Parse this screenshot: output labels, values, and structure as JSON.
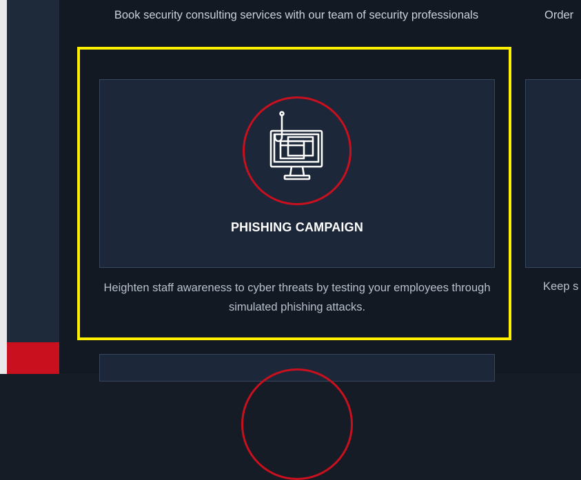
{
  "consulting": {
    "description": "Book security consulting services with our team of security professionals"
  },
  "right_column": {
    "top_text": "Order",
    "bottom_text": "Keep s"
  },
  "phishing_card": {
    "title": "PHISHING CAMPAIGN",
    "description": "Heighten staff awareness to cyber threats by testing your employees through simulated phishing attacks.",
    "icon": "phishing-monitor-icon"
  },
  "colors": {
    "accent": "#c8101e",
    "highlight": "#fff000",
    "card_bg": "#1c2739",
    "page_bg": "#121923"
  }
}
